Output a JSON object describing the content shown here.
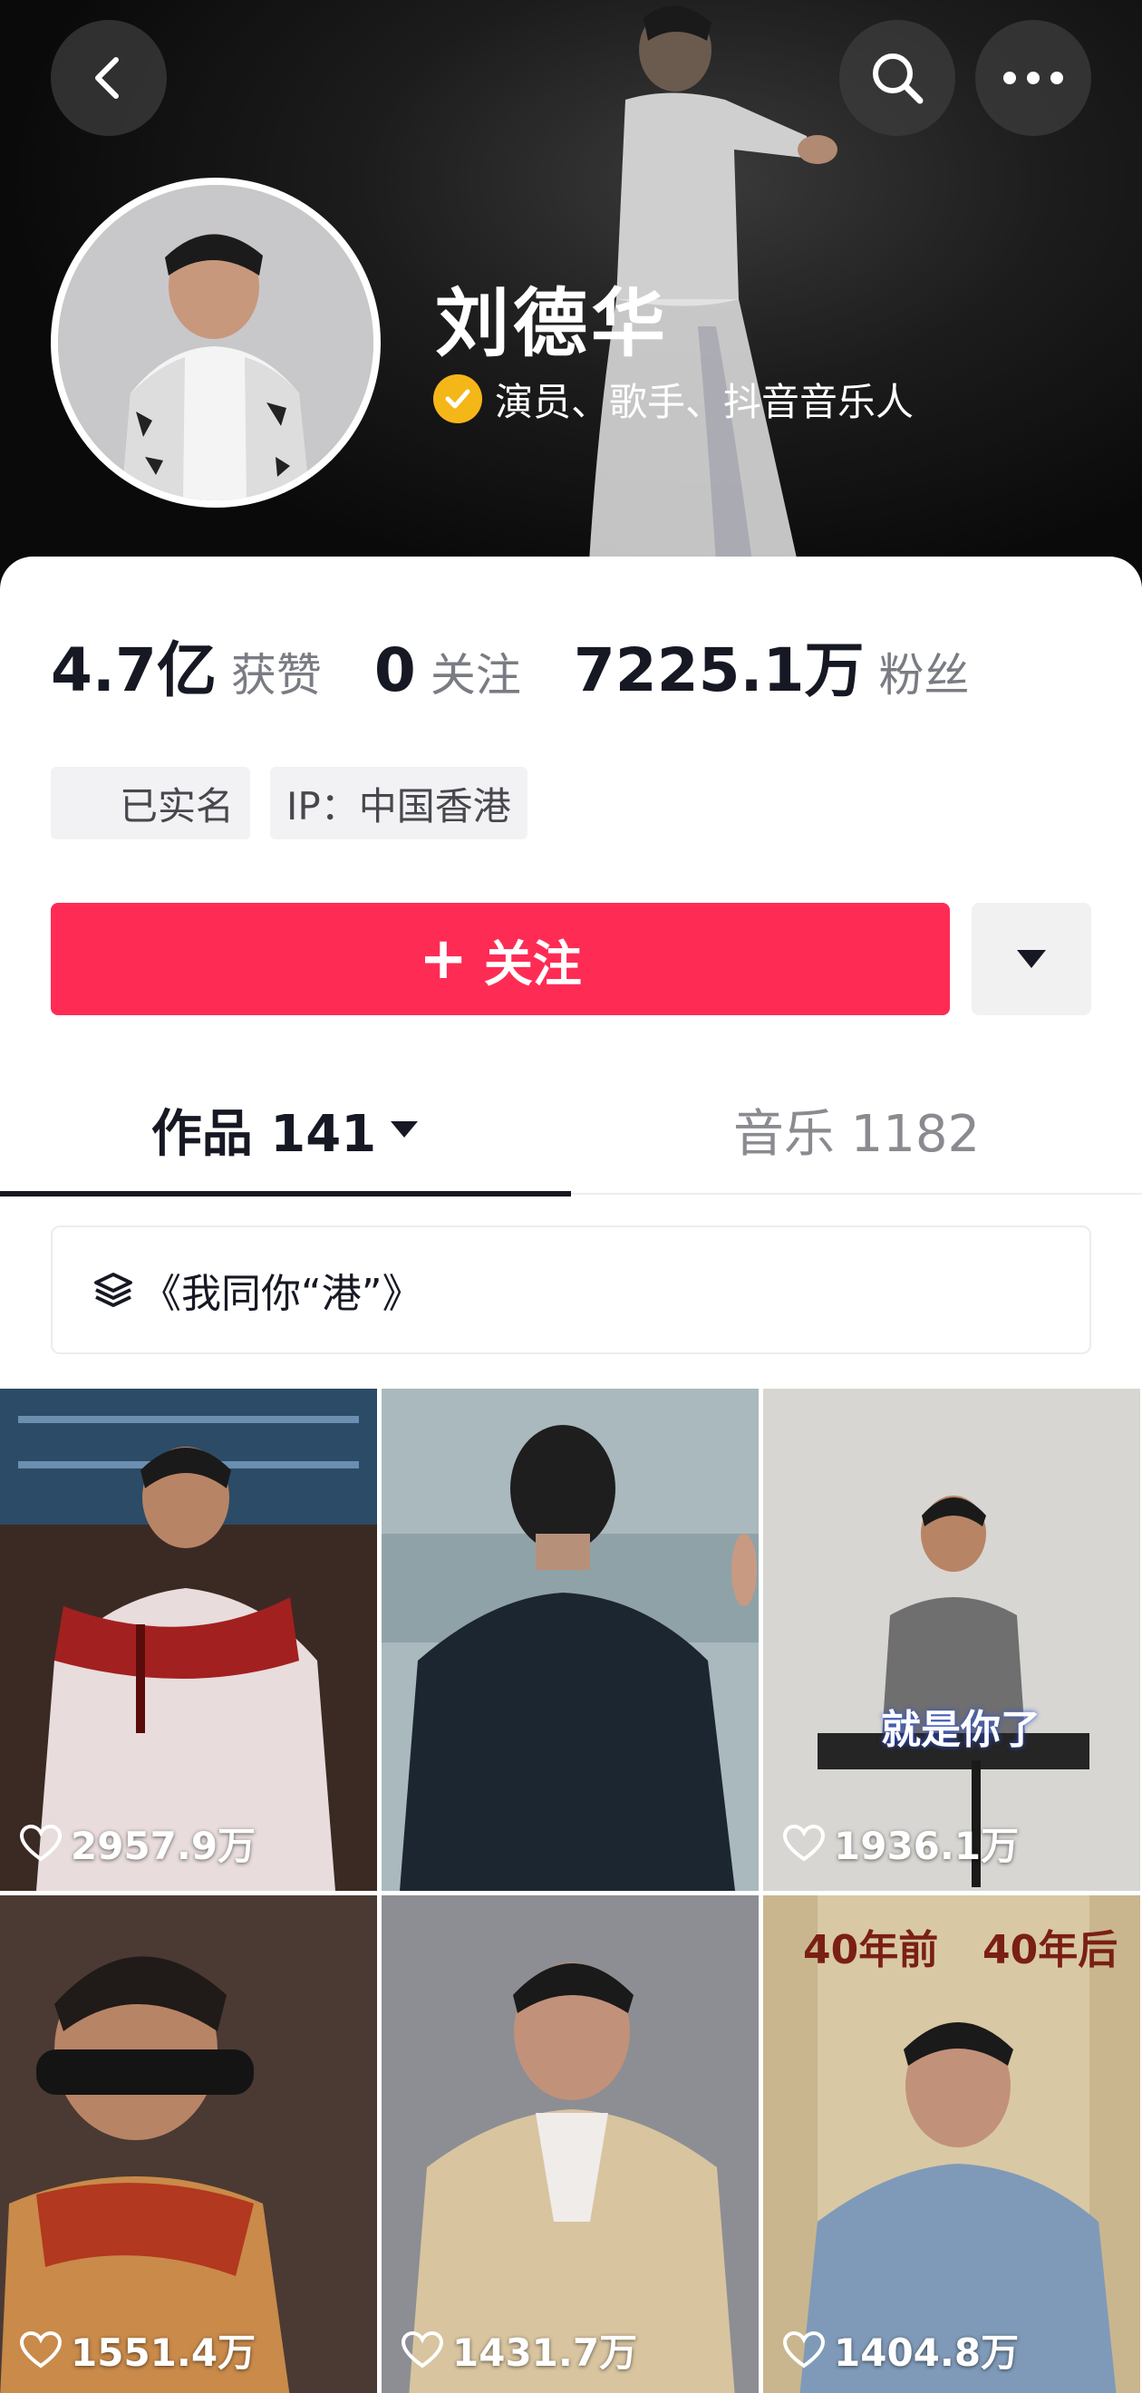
{
  "header": {
    "name": "刘德华",
    "verification": "演员、歌手、抖音音乐人"
  },
  "stats": {
    "likes": {
      "value": "4.7亿",
      "label": "获赞"
    },
    "following": {
      "value": "0",
      "label": "关注"
    },
    "followers": {
      "value": "7225.1万",
      "label": "粉丝"
    }
  },
  "tags": [
    "已实名",
    "IP：中国香港"
  ],
  "follow_button": {
    "label": "关注"
  },
  "tabs": [
    {
      "label": "作品 141"
    },
    {
      "label": "音乐 1182"
    }
  ],
  "collection": {
    "label": "《我同你“港”》"
  },
  "videos": [
    {
      "likes": "2957.9万",
      "caption": ""
    },
    {
      "likes": "",
      "caption": ""
    },
    {
      "likes": "1936.1万",
      "caption": "就是你了"
    },
    {
      "likes": "1551.4万",
      "caption": ""
    },
    {
      "likes": "1431.7万",
      "caption": ""
    },
    {
      "likes": "1404.8万",
      "caption_left": "40年前",
      "caption_right": "40年后"
    }
  ],
  "colors": {
    "accent": "#fe2c55",
    "verified": "#f5b618",
    "banner": "#0a0a0a"
  },
  "icons": [
    "back-icon",
    "search-icon",
    "more-icon",
    "verified-icon",
    "caret-down-icon",
    "layers-icon",
    "heart-icon"
  ]
}
